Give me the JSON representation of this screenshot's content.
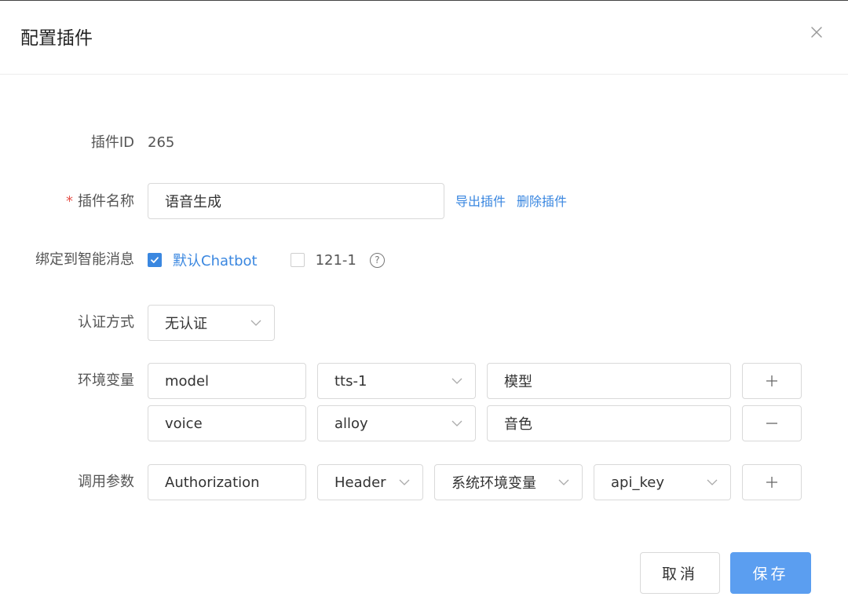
{
  "dialog": {
    "title": "配置插件",
    "close_icon": "close-icon"
  },
  "form": {
    "plugin_id": {
      "label": "插件ID",
      "value": "265"
    },
    "plugin_name": {
      "label": "插件名称",
      "required_mark": "*",
      "value": "语音生成",
      "export_link": "导出插件",
      "delete_link": "删除插件"
    },
    "bind": {
      "label": "绑定到智能消息",
      "options": [
        {
          "label": "默认Chatbot",
          "checked": true
        },
        {
          "label": "121-1",
          "checked": false
        }
      ],
      "help_icon": "question-circle-icon",
      "help_glyph": "?"
    },
    "auth": {
      "label": "认证方式",
      "value": "无认证"
    },
    "env": {
      "label": "环境变量",
      "rows": [
        {
          "key": "model",
          "value": "tts-1",
          "desc": "模型",
          "action_icon": "plus-icon"
        },
        {
          "key": "voice",
          "value": "alloy",
          "desc": "音色",
          "action_icon": "minus-icon"
        }
      ]
    },
    "params": {
      "label": "调用参数",
      "row": {
        "name": "Authorization",
        "location": "Header",
        "source": "系统环境变量",
        "variable": "api_key",
        "action_icon": "plus-icon"
      }
    }
  },
  "footer": {
    "cancel_label": "取消",
    "save_label": "保存"
  },
  "colors": {
    "accent": "#3a87e0",
    "primary_button": "#5b9ef0",
    "required": "#e5534b",
    "border": "#d9d9d9"
  }
}
